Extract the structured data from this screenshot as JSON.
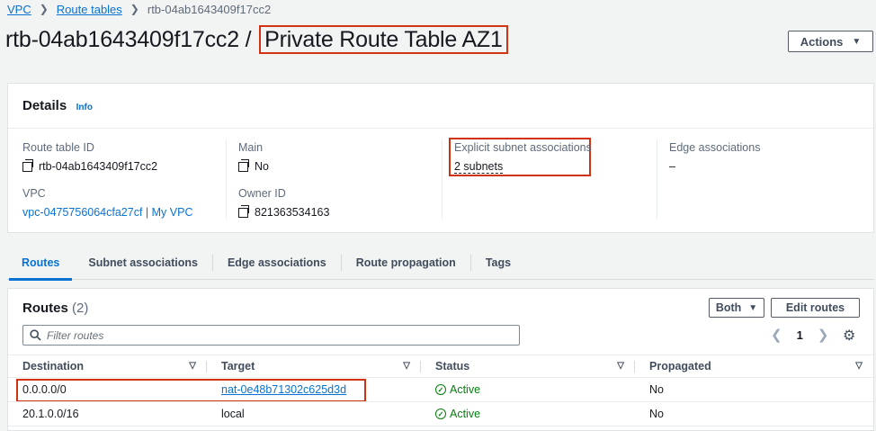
{
  "breadcrumb": {
    "vpc": "VPC",
    "route_tables": "Route tables",
    "current": "rtb-04ab1643409f17cc2"
  },
  "title": {
    "id": "rtb-04ab1643409f17cc2",
    "separator": "/",
    "name": "Private Route Table AZ1"
  },
  "actions_label": "Actions",
  "details": {
    "title": "Details",
    "info": "Info",
    "route_table_id_label": "Route table ID",
    "route_table_id": "rtb-04ab1643409f17cc2",
    "main_label": "Main",
    "main": "No",
    "explicit_label": "Explicit subnet associations",
    "explicit": "2 subnets",
    "edge_label": "Edge associations",
    "edge": "–",
    "vpc_label": "VPC",
    "vpc": "vpc-0475756064cfa27cf | My VPC",
    "owner_label": "Owner ID",
    "owner": "821363534163"
  },
  "tabs": [
    "Routes",
    "Subnet associations",
    "Edge associations",
    "Route propagation",
    "Tags"
  ],
  "routes": {
    "title": "Routes",
    "count": "(2)",
    "filter_select": "Both",
    "edit_label": "Edit routes",
    "filter_placeholder": "Filter routes",
    "page": "1",
    "columns": [
      "Destination",
      "Target",
      "Status",
      "Propagated"
    ],
    "rows": [
      {
        "destination": "0.0.0.0/0",
        "target": "nat-0e48b71302c625d3d",
        "status": "Active",
        "propagated": "No"
      },
      {
        "destination": "20.1.0.0/16",
        "target": "local",
        "status": "Active",
        "propagated": "No"
      }
    ]
  },
  "colors": {
    "accent": "#0972d3",
    "success": "#037f0c",
    "highlight": "#d13212"
  }
}
